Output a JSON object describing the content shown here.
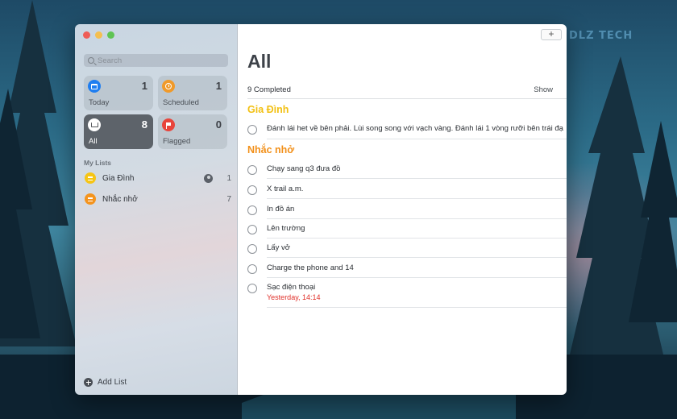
{
  "desktop": {
    "watermark": "DLZ TECH"
  },
  "sidebar": {
    "search": {
      "placeholder": "Search"
    },
    "smart_lists": [
      {
        "label": "Today",
        "count": "1",
        "icon": "calendar-icon",
        "color": "#1f7ef0"
      },
      {
        "label": "Scheduled",
        "count": "1",
        "icon": "clock-icon",
        "color": "#f09a2a"
      },
      {
        "label": "All",
        "count": "8",
        "icon": "tray-icon",
        "color": "#56585c"
      },
      {
        "label": "Flagged",
        "count": "0",
        "icon": "flag-icon",
        "color": "#e8453c"
      }
    ],
    "my_lists_title": "My Lists",
    "lists": [
      {
        "name": "Gia Đình",
        "count": "1",
        "color": "#f6c515",
        "shared": true
      },
      {
        "name": "Nhắc nhở",
        "count": "7",
        "color": "#f4941d",
        "shared": false
      }
    ],
    "add_list_label": "Add List"
  },
  "main": {
    "add_button": "+",
    "title": "All",
    "completed_text": "9 Completed",
    "show_label": "Show",
    "groups": [
      {
        "name": "Gia Đình",
        "color": "#f2c012",
        "items": [
          {
            "text": "Đánh lái het về bên phải. Lùi song song với vạch vàng. Đánh lái 1 vòng rưỡi bên trái đạ"
          }
        ]
      },
      {
        "name": "Nhắc nhở",
        "color": "#f2901a",
        "items": [
          {
            "text": "Chạy sang q3 đưa đồ"
          },
          {
            "text": "X trail a.m."
          },
          {
            "text": "In đồ án"
          },
          {
            "text": "Lên trường"
          },
          {
            "text": "Lấy vở"
          },
          {
            "text": "Charge the phone and 14"
          },
          {
            "text": "Sạc điện thoại",
            "due": "Yesterday, 14:14"
          }
        ]
      }
    ]
  }
}
